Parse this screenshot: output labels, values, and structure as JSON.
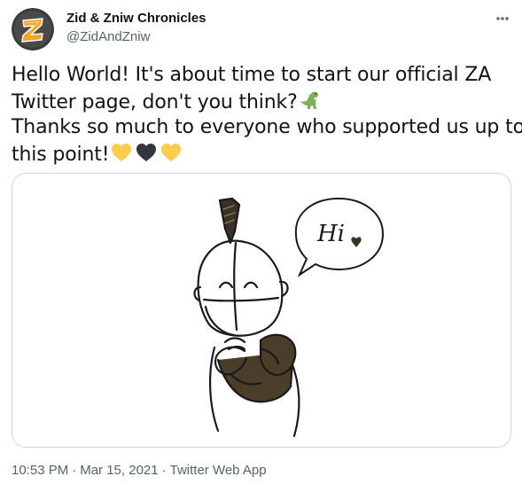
{
  "author": {
    "name": "Zid & Zniw Chronicles",
    "handle": "@ZidAndZniw"
  },
  "tweet": {
    "line1": "Hello World! It's about time to start our official ZA",
    "line2": "Twitter page, don't you think?",
    "line3": "Thanks so much to everyone who supported us up to",
    "line4": "this point!"
  },
  "media": {
    "speech_text": "Hi"
  },
  "meta": {
    "time": "10:53 PM",
    "separator": "·",
    "date": "Mar 15, 2021",
    "source": "Twitter Web App"
  },
  "colors": {
    "text_primary": "#0f1419",
    "text_secondary": "#536471",
    "border": "#cfd9de",
    "heart_yellow": "#ffcc4d",
    "heart_black": "#31373d",
    "dino_green": "#77b255",
    "logo_orange": "#f5a623",
    "sweater_brown": "#4a3d2a"
  },
  "icons": {
    "more": "more-horizontal-icon",
    "dinosaur": "t-rex-emoji",
    "yellow_heart": "yellow-heart-emoji",
    "black_heart": "black-heart-emoji"
  }
}
